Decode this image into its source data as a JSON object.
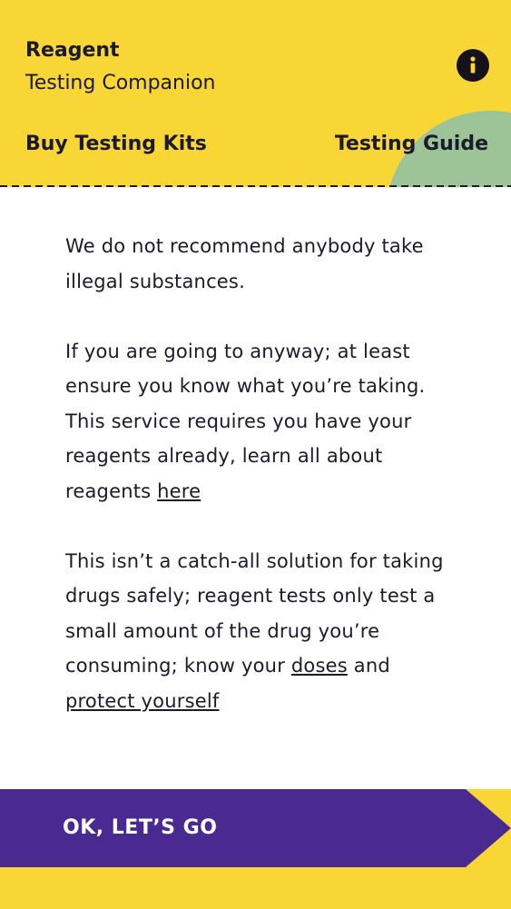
{
  "header": {
    "title_line1": "Reagent",
    "title_line2": "Testing Companion",
    "info_icon": "info-icon",
    "nav": {
      "buy_kits": "Buy Testing Kits",
      "testing_guide": "Testing Guide"
    }
  },
  "content": {
    "p1": "We do not recommend anybody take illegal substances.",
    "p2_text": "If you are going to anyway; at least ensure you know what you’re taking. This service requires you have your reagents already, learn all about reagents ",
    "p2_link": "here",
    "p3_text": "This isn’t a catch-all solution for taking drugs safely; reagent tests only test a small amount of the drug you’re consuming; know your ",
    "p3_link1": "doses",
    "p3_and": " and ",
    "p3_link2": "protect yourself"
  },
  "cta": {
    "label": "OK, LET’S GO"
  },
  "colors": {
    "yellow": "#f7d636",
    "green": "#9cc497",
    "purple": "#4a2a91",
    "text": "#1c1a2e"
  }
}
